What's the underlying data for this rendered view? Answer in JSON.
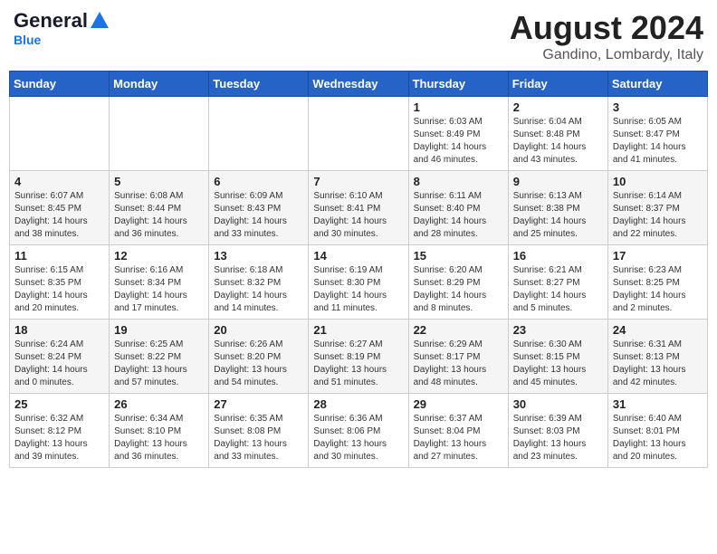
{
  "header": {
    "logo_general": "General",
    "logo_blue": "Blue",
    "month_title": "August 2024",
    "location": "Gandino, Lombardy, Italy"
  },
  "weekdays": [
    "Sunday",
    "Monday",
    "Tuesday",
    "Wednesday",
    "Thursday",
    "Friday",
    "Saturday"
  ],
  "weeks": [
    [
      {
        "day": "",
        "info": ""
      },
      {
        "day": "",
        "info": ""
      },
      {
        "day": "",
        "info": ""
      },
      {
        "day": "",
        "info": ""
      },
      {
        "day": "1",
        "info": "Sunrise: 6:03 AM\nSunset: 8:49 PM\nDaylight: 14 hours\nand 46 minutes."
      },
      {
        "day": "2",
        "info": "Sunrise: 6:04 AM\nSunset: 8:48 PM\nDaylight: 14 hours\nand 43 minutes."
      },
      {
        "day": "3",
        "info": "Sunrise: 6:05 AM\nSunset: 8:47 PM\nDaylight: 14 hours\nand 41 minutes."
      }
    ],
    [
      {
        "day": "4",
        "info": "Sunrise: 6:07 AM\nSunset: 8:45 PM\nDaylight: 14 hours\nand 38 minutes."
      },
      {
        "day": "5",
        "info": "Sunrise: 6:08 AM\nSunset: 8:44 PM\nDaylight: 14 hours\nand 36 minutes."
      },
      {
        "day": "6",
        "info": "Sunrise: 6:09 AM\nSunset: 8:43 PM\nDaylight: 14 hours\nand 33 minutes."
      },
      {
        "day": "7",
        "info": "Sunrise: 6:10 AM\nSunset: 8:41 PM\nDaylight: 14 hours\nand 30 minutes."
      },
      {
        "day": "8",
        "info": "Sunrise: 6:11 AM\nSunset: 8:40 PM\nDaylight: 14 hours\nand 28 minutes."
      },
      {
        "day": "9",
        "info": "Sunrise: 6:13 AM\nSunset: 8:38 PM\nDaylight: 14 hours\nand 25 minutes."
      },
      {
        "day": "10",
        "info": "Sunrise: 6:14 AM\nSunset: 8:37 PM\nDaylight: 14 hours\nand 22 minutes."
      }
    ],
    [
      {
        "day": "11",
        "info": "Sunrise: 6:15 AM\nSunset: 8:35 PM\nDaylight: 14 hours\nand 20 minutes."
      },
      {
        "day": "12",
        "info": "Sunrise: 6:16 AM\nSunset: 8:34 PM\nDaylight: 14 hours\nand 17 minutes."
      },
      {
        "day": "13",
        "info": "Sunrise: 6:18 AM\nSunset: 8:32 PM\nDaylight: 14 hours\nand 14 minutes."
      },
      {
        "day": "14",
        "info": "Sunrise: 6:19 AM\nSunset: 8:30 PM\nDaylight: 14 hours\nand 11 minutes."
      },
      {
        "day": "15",
        "info": "Sunrise: 6:20 AM\nSunset: 8:29 PM\nDaylight: 14 hours\nand 8 minutes."
      },
      {
        "day": "16",
        "info": "Sunrise: 6:21 AM\nSunset: 8:27 PM\nDaylight: 14 hours\nand 5 minutes."
      },
      {
        "day": "17",
        "info": "Sunrise: 6:23 AM\nSunset: 8:25 PM\nDaylight: 14 hours\nand 2 minutes."
      }
    ],
    [
      {
        "day": "18",
        "info": "Sunrise: 6:24 AM\nSunset: 8:24 PM\nDaylight: 14 hours\nand 0 minutes."
      },
      {
        "day": "19",
        "info": "Sunrise: 6:25 AM\nSunset: 8:22 PM\nDaylight: 13 hours\nand 57 minutes."
      },
      {
        "day": "20",
        "info": "Sunrise: 6:26 AM\nSunset: 8:20 PM\nDaylight: 13 hours\nand 54 minutes."
      },
      {
        "day": "21",
        "info": "Sunrise: 6:27 AM\nSunset: 8:19 PM\nDaylight: 13 hours\nand 51 minutes."
      },
      {
        "day": "22",
        "info": "Sunrise: 6:29 AM\nSunset: 8:17 PM\nDaylight: 13 hours\nand 48 minutes."
      },
      {
        "day": "23",
        "info": "Sunrise: 6:30 AM\nSunset: 8:15 PM\nDaylight: 13 hours\nand 45 minutes."
      },
      {
        "day": "24",
        "info": "Sunrise: 6:31 AM\nSunset: 8:13 PM\nDaylight: 13 hours\nand 42 minutes."
      }
    ],
    [
      {
        "day": "25",
        "info": "Sunrise: 6:32 AM\nSunset: 8:12 PM\nDaylight: 13 hours\nand 39 minutes."
      },
      {
        "day": "26",
        "info": "Sunrise: 6:34 AM\nSunset: 8:10 PM\nDaylight: 13 hours\nand 36 minutes."
      },
      {
        "day": "27",
        "info": "Sunrise: 6:35 AM\nSunset: 8:08 PM\nDaylight: 13 hours\nand 33 minutes."
      },
      {
        "day": "28",
        "info": "Sunrise: 6:36 AM\nSunset: 8:06 PM\nDaylight: 13 hours\nand 30 minutes."
      },
      {
        "day": "29",
        "info": "Sunrise: 6:37 AM\nSunset: 8:04 PM\nDaylight: 13 hours\nand 27 minutes."
      },
      {
        "day": "30",
        "info": "Sunrise: 6:39 AM\nSunset: 8:03 PM\nDaylight: 13 hours\nand 23 minutes."
      },
      {
        "day": "31",
        "info": "Sunrise: 6:40 AM\nSunset: 8:01 PM\nDaylight: 13 hours\nand 20 minutes."
      }
    ]
  ]
}
